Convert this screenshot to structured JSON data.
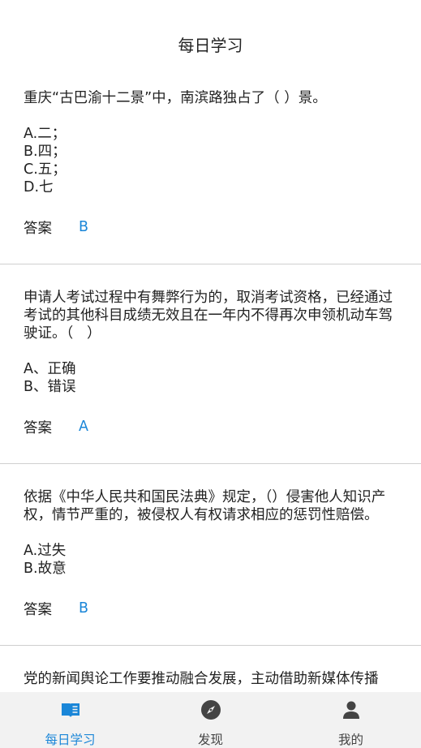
{
  "header": {
    "title": "每日学习"
  },
  "questions": [
    {
      "text": "重庆“古巴渝十二景”中，南滨路独占了（ ）景。",
      "options": [
        "A.二；",
        "B.四；",
        "C.五；",
        "D.七"
      ],
      "answer_label": "答案",
      "answer": "B"
    },
    {
      "text": "申请人考试过程中有舞弊行为的，取消考试资格，已经通过考试的其他科目成绩无效且在一年内不得再次申领机动车驾驶证。（   ）",
      "options": [
        "A、正确",
        "B、错误"
      ],
      "answer_label": "答案",
      "answer": "A"
    },
    {
      "text": "依据《中华人民共和国民法典》规定，（）侵害他人知识产权，情节严重的，被侵权人有权请求相应的惩罚性赔偿。",
      "options": [
        "A.过失",
        "B.故意"
      ],
      "answer_label": "答案",
      "answer": "B"
    },
    {
      "text": "党的新闻舆论工作要推动融合发展，主动借助新媒体传播",
      "options": [],
      "answer_label": "",
      "answer": ""
    }
  ],
  "tabbar": {
    "items": [
      {
        "label": "每日学习",
        "icon": "book-icon",
        "active": true
      },
      {
        "label": "发现",
        "icon": "compass-icon",
        "active": false
      },
      {
        "label": "我的",
        "icon": "person-icon",
        "active": false
      }
    ]
  },
  "colors": {
    "accent": "#1a86d8",
    "inactive_icon": "#444444",
    "tabbar_bg": "#f2f2f2"
  }
}
